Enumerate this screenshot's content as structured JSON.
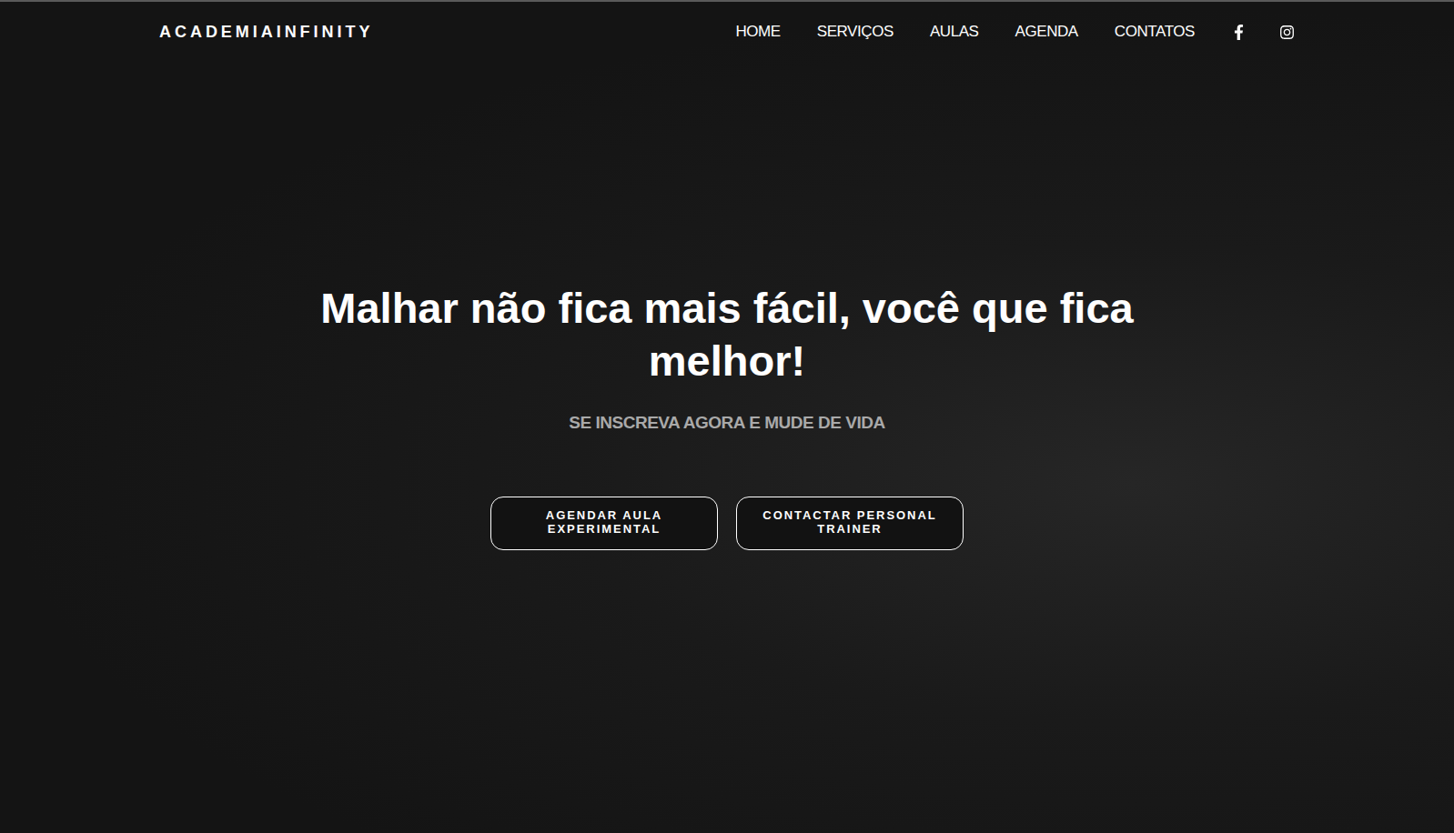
{
  "header": {
    "logo": "ACADEMIAINFINITY",
    "nav": [
      "HOME",
      "SERVIÇOS",
      "AULAS",
      "AGENDA",
      "CONTATOS"
    ],
    "social": [
      "facebook",
      "instagram"
    ]
  },
  "hero": {
    "title": "Malhar não fica mais fácil, você que fica melhor!",
    "subtitle": "SE INSCREVA AGORA E MUDE DE VIDA",
    "buttons": [
      "AGENDAR AULA EXPERIMENTAL",
      "CONTACTAR PERSONAL TRAINER"
    ]
  }
}
